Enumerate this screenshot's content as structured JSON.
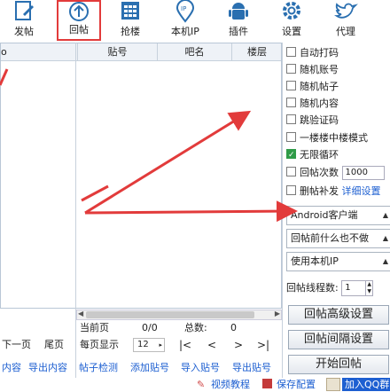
{
  "toolbar": {
    "items": [
      {
        "label": "发帖",
        "icon": "edit-icon"
      },
      {
        "label": "回帖",
        "icon": "reply-upload-icon"
      },
      {
        "label": "抢楼",
        "icon": "calendar-grid-icon"
      },
      {
        "label": "本机IP",
        "icon": "location-ip-icon"
      },
      {
        "label": "插件",
        "icon": "android-plugin-icon"
      },
      {
        "label": "设置",
        "icon": "gear-icon"
      },
      {
        "label": "代理",
        "icon": "twitter-bird-icon"
      }
    ]
  },
  "table": {
    "columns": [
      "贴号",
      "吧名",
      "楼层"
    ],
    "partial_left_header": "o"
  },
  "options": {
    "auto_captcha": "自动打码",
    "random_account": "随机账号",
    "random_post": "随机帖子",
    "random_content": "随机内容",
    "skip_captcha": "跳验证码",
    "floor_in_floor": "一楼楼中楼模式",
    "infinite_loop": "无限循环",
    "reply_count_label": "回帖次数",
    "reply_count_value": "1000",
    "delete_supplement": "删帖补发",
    "detail_settings": "详细设置"
  },
  "selects": {
    "client": "Android客户端",
    "before_reply": "回帖前什么也不做",
    "ip_mode": "使用本机IP"
  },
  "threads": {
    "label": "回帖线程数:",
    "value": "1"
  },
  "buttons": {
    "advanced": "回帖高级设置",
    "interval": "回帖间隔设置",
    "start": "开始回帖"
  },
  "pagination": {
    "current_label": "当前页",
    "current_value": "0/0",
    "total_label": "总数:",
    "total_value": "0",
    "per_page_label": "每页显示",
    "per_page_value": "12",
    "next_page": "下一页",
    "last_page": "尾页",
    "first": "|<",
    "prev": "<",
    "next": ">",
    "last": ">|"
  },
  "actions": {
    "import_content": "内容",
    "export_content": "导出内容",
    "post_check": "帖子检测",
    "add_post_id": "添加贴号",
    "import_post_id": "导入贴号",
    "export_post_id": "导出贴号"
  },
  "footer": {
    "video_tutorial": "视频教程",
    "save_config": "保存配置",
    "join_qq": "加入QQ群"
  },
  "colors": {
    "highlight": "#e23b3b",
    "link": "#1d5fd1",
    "check_on": "#2f9b48",
    "icon_blue": "#2a6fb0"
  }
}
